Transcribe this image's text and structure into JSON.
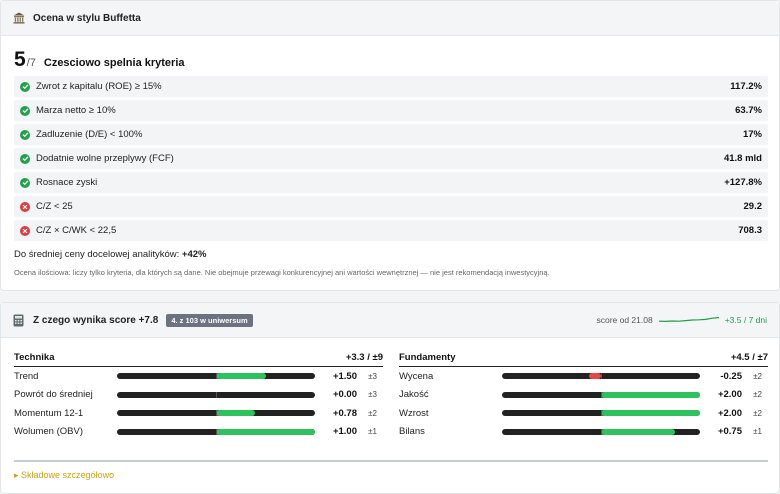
{
  "buffett": {
    "title": "Ocena w stylu Buffetta",
    "score": "5",
    "score_den": "/7",
    "verdict": "Czesciowo spelnia kryteria",
    "criteria": [
      {
        "label": "Zwrot z kapitalu (ROE) ≥ 15%",
        "value": "117.2%",
        "pass": true
      },
      {
        "label": "Marza netto ≥ 10%",
        "value": "63.7%",
        "pass": true
      },
      {
        "label": "Zadluzenie (D/E) < 100%",
        "value": "17%",
        "pass": true
      },
      {
        "label": "Dodatnie wolne przeplywy (FCF)",
        "value": "41.8 mld",
        "pass": true
      },
      {
        "label": "Rosnace zyski",
        "value": "+127.8%",
        "pass": true
      },
      {
        "label": "C/Z < 25",
        "value": "29.2",
        "pass": false
      },
      {
        "label": "C/Z × C/WK < 22,5",
        "value": "708.3",
        "pass": false
      }
    ],
    "target_prefix": "Do średniej ceny docelowej analityków:",
    "target_value": "+42%",
    "note": "Ocena ilościowa: liczy tylko kryteria, dla których są dane. Nie obejmuje przewagi konkurencyjnej ani wartości wewnętrznej — nie jest rekomendacją inwestycyjną."
  },
  "score": {
    "title": "Z czego wynika score +7.8",
    "badge": "4. z 103 w uniwersum",
    "since": "score od 21.08",
    "delta": "+3.5 / 7 dni",
    "spark": [
      0.6,
      0.62,
      0.58,
      0.6,
      0.55,
      0.5,
      0.48,
      0.45,
      0.35,
      0.3
    ],
    "colors": {
      "positive": "#2fc15d",
      "negative": "#e4474a",
      "delta": "#1f9d45",
      "link": "#c9a211"
    },
    "technika": {
      "title": "Technika",
      "total": "+3.3 / ±9",
      "rows": [
        {
          "name": "Trend",
          "value": "+1.50",
          "range": "±3",
          "v": 1.5,
          "max": 3
        },
        {
          "name": "Powrót do średniej",
          "value": "+0.00",
          "range": "±3",
          "v": 0.0,
          "max": 3
        },
        {
          "name": "Momentum 12-1",
          "value": "+0.78",
          "range": "±2",
          "v": 0.78,
          "max": 2
        },
        {
          "name": "Wolumen (OBV)",
          "value": "+1.00",
          "range": "±1",
          "v": 1.0,
          "max": 1
        }
      ]
    },
    "fundamenty": {
      "title": "Fundamenty",
      "total": "+4.5 / ±7",
      "rows": [
        {
          "name": "Wycena",
          "value": "-0.25",
          "range": "±2",
          "v": -0.25,
          "max": 2
        },
        {
          "name": "Jakość",
          "value": "+2.00",
          "range": "±2",
          "v": 2.0,
          "max": 2
        },
        {
          "name": "Wzrost",
          "value": "+2.00",
          "range": "±2",
          "v": 2.0,
          "max": 2
        },
        {
          "name": "Bilans",
          "value": "+0.75",
          "range": "±1",
          "v": 0.75,
          "max": 1
        }
      ]
    },
    "details_link": "▸ Składowe szczegółowo"
  }
}
